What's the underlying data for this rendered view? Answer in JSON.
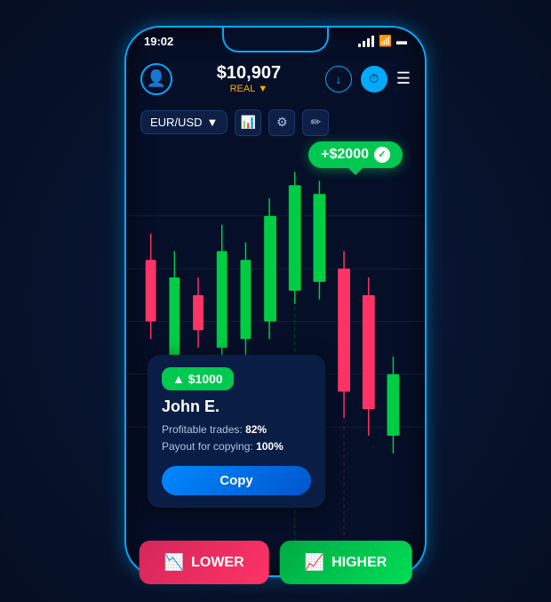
{
  "phone": {
    "status_time": "19:02",
    "balance": "$10,907",
    "balance_label": "REAL",
    "pair": "EUR/USD",
    "profit_badge": "+$2000",
    "trader": {
      "profit": "▲ $1000",
      "name": "John E.",
      "profitable_trades_label": "Profitable trades:",
      "profitable_trades_value": "82%",
      "payout_label": "Payout for copying:",
      "payout_value": "100%",
      "copy_button": "Copy"
    },
    "buttons": {
      "lower": "LOWER",
      "higher": "HIGHER"
    }
  }
}
